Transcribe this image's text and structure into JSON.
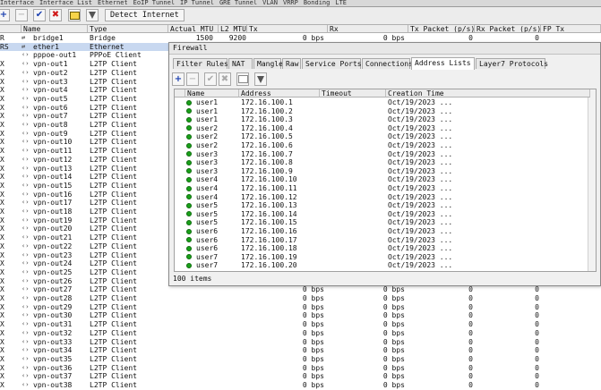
{
  "top_tabs": [
    "Interface",
    "Interface List",
    "Ethernet",
    "EoIP Tunnel",
    "IP Tunnel",
    "GRE Tunnel",
    "VLAN",
    "VRRP",
    "Bonding",
    "LTE"
  ],
  "toolbar": {
    "add_icon": "+",
    "remove_icon": "−",
    "enable_icon": "✔",
    "disable_icon": "✖",
    "detect_internet_label": "Detect Internet"
  },
  "grid": {
    "headers": [
      "",
      "Name",
      "Type",
      "Actual MTU",
      "L2 MTU",
      "Tx",
      "Rx",
      "Tx Packet (p/s)",
      "Rx Packet (p/s)",
      "FP Tx"
    ],
    "rows": [
      {
        "flag": "R",
        "name": "bridge1",
        "type": "Bridge",
        "mtu": "1500",
        "l2mtu": "9200",
        "tx": "0 bps",
        "rx": "0 bps",
        "txp": "0",
        "rxp": "0",
        "icon": "⇄"
      },
      {
        "flag": "RS",
        "name": "ether1",
        "type": "Ethernet",
        "mtu": "",
        "l2mtu": "",
        "tx": "",
        "rx": "",
        "txp": "",
        "rxp": "",
        "icon": "⇄"
      },
      {
        "flag": "",
        "name": "pppoe-out1",
        "type": "PPPoE Client",
        "mtu": "",
        "l2mtu": "",
        "tx": "",
        "rx": "",
        "txp": "",
        "rxp": "",
        "icon": "‹›"
      },
      {
        "flag": "X",
        "name": "vpn-out1",
        "type": "L2TP Client",
        "tx": "",
        "rx": "",
        "txp": "",
        "rxp": "",
        "icon": "‹›"
      },
      {
        "flag": "X",
        "name": "vpn-out2",
        "type": "L2TP Client",
        "tx": "",
        "rx": "",
        "txp": "",
        "rxp": "",
        "icon": "‹›"
      },
      {
        "flag": "X",
        "name": "vpn-out3",
        "type": "L2TP Client",
        "tx": "",
        "rx": "",
        "txp": "",
        "rxp": "",
        "icon": "‹›"
      },
      {
        "flag": "X",
        "name": "vpn-out4",
        "type": "L2TP Client",
        "tx": "",
        "rx": "",
        "txp": "",
        "rxp": "",
        "icon": "‹›"
      },
      {
        "flag": "X",
        "name": "vpn-out5",
        "type": "L2TP Client",
        "tx": "",
        "rx": "",
        "txp": "",
        "rxp": "",
        "icon": "‹›"
      },
      {
        "flag": "X",
        "name": "vpn-out6",
        "type": "L2TP Client",
        "tx": "",
        "rx": "",
        "txp": "",
        "rxp": "",
        "icon": "‹›"
      },
      {
        "flag": "X",
        "name": "vpn-out7",
        "type": "L2TP Client",
        "tx": "",
        "rx": "",
        "txp": "",
        "rxp": "",
        "icon": "‹›"
      },
      {
        "flag": "X",
        "name": "vpn-out8",
        "type": "L2TP Client",
        "tx": "",
        "rx": "",
        "txp": "",
        "rxp": "",
        "icon": "‹›"
      },
      {
        "flag": "X",
        "name": "vpn-out9",
        "type": "L2TP Client",
        "tx": "",
        "rx": "",
        "txp": "",
        "rxp": "",
        "icon": "‹›"
      },
      {
        "flag": "X",
        "name": "vpn-out10",
        "type": "L2TP Client",
        "tx": "",
        "rx": "",
        "txp": "",
        "rxp": "",
        "icon": "‹›"
      },
      {
        "flag": "X",
        "name": "vpn-out11",
        "type": "L2TP Client",
        "tx": "",
        "rx": "",
        "txp": "",
        "rxp": "",
        "icon": "‹›"
      },
      {
        "flag": "X",
        "name": "vpn-out12",
        "type": "L2TP Client",
        "tx": "",
        "rx": "",
        "txp": "",
        "rxp": "",
        "icon": "‹›"
      },
      {
        "flag": "X",
        "name": "vpn-out13",
        "type": "L2TP Client",
        "tx": "",
        "rx": "",
        "txp": "",
        "rxp": "",
        "icon": "‹›"
      },
      {
        "flag": "X",
        "name": "vpn-out14",
        "type": "L2TP Client",
        "tx": "",
        "rx": "",
        "txp": "",
        "rxp": "",
        "icon": "‹›"
      },
      {
        "flag": "X",
        "name": "vpn-out15",
        "type": "L2TP Client",
        "tx": "",
        "rx": "",
        "txp": "",
        "rxp": "",
        "icon": "‹›"
      },
      {
        "flag": "X",
        "name": "vpn-out16",
        "type": "L2TP Client",
        "tx": "",
        "rx": "",
        "txp": "",
        "rxp": "",
        "icon": "‹›"
      },
      {
        "flag": "X",
        "name": "vpn-out17",
        "type": "L2TP Client",
        "tx": "",
        "rx": "",
        "txp": "",
        "rxp": "",
        "icon": "‹›"
      },
      {
        "flag": "X",
        "name": "vpn-out18",
        "type": "L2TP Client",
        "tx": "",
        "rx": "",
        "txp": "",
        "rxp": "",
        "icon": "‹›"
      },
      {
        "flag": "X",
        "name": "vpn-out19",
        "type": "L2TP Client",
        "tx": "",
        "rx": "",
        "txp": "",
        "rxp": "",
        "icon": "‹›"
      },
      {
        "flag": "X",
        "name": "vpn-out20",
        "type": "L2TP Client",
        "tx": "",
        "rx": "",
        "txp": "",
        "rxp": "",
        "icon": "‹›"
      },
      {
        "flag": "X",
        "name": "vpn-out21",
        "type": "L2TP Client",
        "tx": "",
        "rx": "",
        "txp": "",
        "rxp": "",
        "icon": "‹›"
      },
      {
        "flag": "X",
        "name": "vpn-out22",
        "type": "L2TP Client",
        "tx": "",
        "rx": "",
        "txp": "",
        "rxp": "",
        "icon": "‹›"
      },
      {
        "flag": "X",
        "name": "vpn-out23",
        "type": "L2TP Client",
        "tx": "",
        "rx": "",
        "txp": "",
        "rxp": "",
        "icon": "‹›"
      },
      {
        "flag": "X",
        "name": "vpn-out24",
        "type": "L2TP Client",
        "tx": "",
        "rx": "",
        "txp": "",
        "rxp": "",
        "icon": "‹›"
      },
      {
        "flag": "X",
        "name": "vpn-out25",
        "type": "L2TP Client",
        "tx": "",
        "rx": "",
        "txp": "",
        "rxp": "",
        "icon": "‹›"
      },
      {
        "flag": "X",
        "name": "vpn-out26",
        "type": "L2TP Client",
        "tx": "",
        "rx": "",
        "txp": "",
        "rxp": "",
        "icon": "‹›"
      },
      {
        "flag": "X",
        "name": "vpn-out27",
        "type": "L2TP Client",
        "tx": "0 bps",
        "rx": "0 bps",
        "txp": "0",
        "rxp": "0",
        "icon": "‹›"
      },
      {
        "flag": "X",
        "name": "vpn-out28",
        "type": "L2TP Client",
        "tx": "0 bps",
        "rx": "0 bps",
        "txp": "0",
        "rxp": "0",
        "icon": "‹›"
      },
      {
        "flag": "X",
        "name": "vpn-out29",
        "type": "L2TP Client",
        "tx": "0 bps",
        "rx": "0 bps",
        "txp": "0",
        "rxp": "0",
        "icon": "‹›"
      },
      {
        "flag": "X",
        "name": "vpn-out30",
        "type": "L2TP Client",
        "tx": "0 bps",
        "rx": "0 bps",
        "txp": "0",
        "rxp": "0",
        "icon": "‹›"
      },
      {
        "flag": "X",
        "name": "vpn-out31",
        "type": "L2TP Client",
        "tx": "0 bps",
        "rx": "0 bps",
        "txp": "0",
        "rxp": "0",
        "icon": "‹›"
      },
      {
        "flag": "X",
        "name": "vpn-out32",
        "type": "L2TP Client",
        "tx": "0 bps",
        "rx": "0 bps",
        "txp": "0",
        "rxp": "0",
        "icon": "‹›"
      },
      {
        "flag": "X",
        "name": "vpn-out33",
        "type": "L2TP Client",
        "tx": "0 bps",
        "rx": "0 bps",
        "txp": "0",
        "rxp": "0",
        "icon": "‹›"
      },
      {
        "flag": "X",
        "name": "vpn-out34",
        "type": "L2TP Client",
        "tx": "0 bps",
        "rx": "0 bps",
        "txp": "0",
        "rxp": "0",
        "icon": "‹›"
      },
      {
        "flag": "X",
        "name": "vpn-out35",
        "type": "L2TP Client",
        "tx": "0 bps",
        "rx": "0 bps",
        "txp": "0",
        "rxp": "0",
        "icon": "‹›"
      },
      {
        "flag": "X",
        "name": "vpn-out36",
        "type": "L2TP Client",
        "tx": "0 bps",
        "rx": "0 bps",
        "txp": "0",
        "rxp": "0",
        "icon": "‹›"
      },
      {
        "flag": "X",
        "name": "vpn-out37",
        "type": "L2TP Client",
        "tx": "0 bps",
        "rx": "0 bps",
        "txp": "0",
        "rxp": "0",
        "icon": "‹›"
      },
      {
        "flag": "X",
        "name": "vpn-out38",
        "type": "L2TP Client",
        "tx": "0 bps",
        "rx": "0 bps",
        "txp": "0",
        "rxp": "0",
        "icon": "‹›"
      }
    ]
  },
  "firewall": {
    "title": "Firewall",
    "tabs": [
      "Filter Rules",
      "NAT",
      "Mangle",
      "Raw",
      "Service Ports",
      "Connections",
      "Address Lists",
      "Layer7 Protocols"
    ],
    "active_tab": "Address Lists",
    "headers": [
      "",
      "Name",
      "Address",
      "Timeout",
      "Creation Time"
    ],
    "entries": [
      {
        "name": "user1",
        "address": "172.16.100.1",
        "created": "Oct/19/2023 ..."
      },
      {
        "name": "user1",
        "address": "172.16.100.2",
        "created": "Oct/19/2023 ..."
      },
      {
        "name": "user1",
        "address": "172.16.100.3",
        "created": "Oct/19/2023 ..."
      },
      {
        "name": "user2",
        "address": "172.16.100.4",
        "created": "Oct/19/2023 ..."
      },
      {
        "name": "user2",
        "address": "172.16.100.5",
        "created": "Oct/19/2023 ..."
      },
      {
        "name": "user2",
        "address": "172.16.100.6",
        "created": "Oct/19/2023 ..."
      },
      {
        "name": "user3",
        "address": "172.16.100.7",
        "created": "Oct/19/2023 ..."
      },
      {
        "name": "user3",
        "address": "172.16.100.8",
        "created": "Oct/19/2023 ..."
      },
      {
        "name": "user3",
        "address": "172.16.100.9",
        "created": "Oct/19/2023 ..."
      },
      {
        "name": "user4",
        "address": "172.16.100.10",
        "created": "Oct/19/2023 ..."
      },
      {
        "name": "user4",
        "address": "172.16.100.11",
        "created": "Oct/19/2023 ..."
      },
      {
        "name": "user4",
        "address": "172.16.100.12",
        "created": "Oct/19/2023 ..."
      },
      {
        "name": "user5",
        "address": "172.16.100.13",
        "created": "Oct/19/2023 ..."
      },
      {
        "name": "user5",
        "address": "172.16.100.14",
        "created": "Oct/19/2023 ..."
      },
      {
        "name": "user5",
        "address": "172.16.100.15",
        "created": "Oct/19/2023 ..."
      },
      {
        "name": "user6",
        "address": "172.16.100.16",
        "created": "Oct/19/2023 ..."
      },
      {
        "name": "user6",
        "address": "172.16.100.17",
        "created": "Oct/19/2023 ..."
      },
      {
        "name": "user6",
        "address": "172.16.100.18",
        "created": "Oct/19/2023 ..."
      },
      {
        "name": "user7",
        "address": "172.16.100.19",
        "created": "Oct/19/2023 ..."
      },
      {
        "name": "user7",
        "address": "172.16.100.20",
        "created": "Oct/19/2023 ..."
      }
    ],
    "status": "100 items"
  },
  "colors": {
    "accent": "#1a3fb0",
    "selection": "#c8d8f0",
    "enabled_dot": "#19a019",
    "remove": "#d01818"
  }
}
